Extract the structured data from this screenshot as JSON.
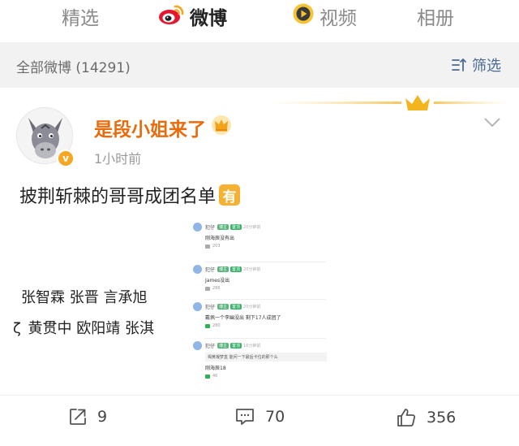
{
  "tabs": [
    {
      "label": "精选",
      "icon": "none",
      "active": false
    },
    {
      "label": "微博",
      "icon": "weibo-logo-icon",
      "active": true
    },
    {
      "label": "视频",
      "icon": "video-icon",
      "active": false
    },
    {
      "label": "相册",
      "icon": "none",
      "active": false
    }
  ],
  "filter_bar": {
    "title": "全部微博 (14291)",
    "filter_label": "筛选",
    "filter_icon": "filter-icon"
  },
  "post": {
    "author": "是段小姐来了",
    "time": "1小时前",
    "text": "披荆斩棘的哥哥成团名单",
    "emoji": "有",
    "names_line_1": "张智霖 张晋 言承旭 ",
    "names_line_2": "黄贯中 欧阳靖 张淇",
    "names_line_2_prefix": "ζ",
    "comments": [
      {
        "name": "犯仔",
        "badge": "博主",
        "badge2": "置顶",
        "time": "20分钟前",
        "text": "刚海辰没有出",
        "likes": "203"
      },
      {
        "name": "犯仔",
        "badge": "博主",
        "badge2": "置顶",
        "time": "20分钟前",
        "text": "James没出",
        "likes": "286"
      },
      {
        "name": "犯仔",
        "badge": "博主",
        "badge2": "置顶",
        "time": "20分钟前",
        "text": "戴佩一个李幽没出 剩下17人成团了",
        "likes": "280"
      },
      {
        "name": "犯仔",
        "badge": "博主",
        "badge2": "置顶",
        "time": "16分钟前",
        "quote": "褐黄凝梦盒 能问一下最后卡位的那个么",
        "text": "刚海辰18",
        "likes": "46"
      }
    ]
  },
  "actions": {
    "share_count": "9",
    "comment_count": "70",
    "like_count": "356"
  },
  "colors": {
    "author": "#e86b0c",
    "filter_link": "#4a6a98",
    "filter_bg": "#f2f2f2",
    "weibo_red": "#e6162d",
    "badge_orange": "#f5a623"
  }
}
